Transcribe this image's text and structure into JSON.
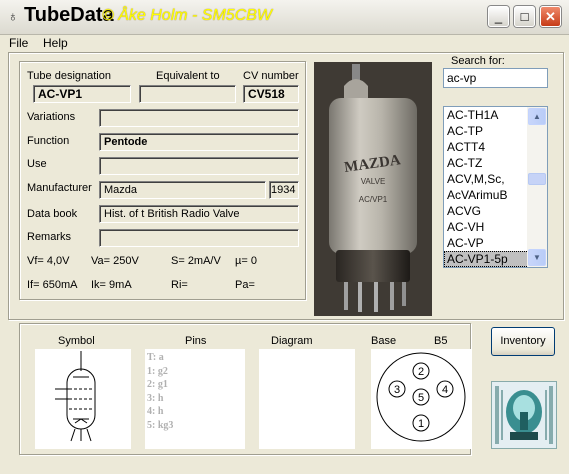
{
  "window": {
    "title": "TubeData",
    "author": "© Åke Holm - SM5CBW",
    "app_icon": "tube-icon",
    "controls": {
      "minimize": "_",
      "maximize": "□",
      "close": "✕"
    }
  },
  "menu": {
    "file": "File",
    "help": "Help"
  },
  "details": {
    "tube_designation_label": "Tube designation",
    "tube_designation_value": "AC-VP1",
    "equivalent_label": "Equivalent to",
    "equivalent_value": "",
    "cv_label": "CV number",
    "cv_value": "CV518",
    "variations_label": "Variations",
    "variations_value": "",
    "function_label": "Function",
    "function_value": "Pentode",
    "use_label": "Use",
    "use_value": "",
    "manufacturer_label": "Manufacturer",
    "manufacturer_value": "Mazda",
    "year_value": "1934",
    "databook_label": "Data book",
    "databook_value": "Hist. of t British Radio Valve",
    "remarks_label": "Remarks",
    "remarks_value": "",
    "vf": "Vf= 4,0V",
    "va": "Va= 250V",
    "s": "S= 2mA/V",
    "mu": "µ=   0",
    "if": "If= 650mA",
    "ik": "Ik=  9mA",
    "ri": "Ri=",
    "pa": "Pa="
  },
  "photo": {
    "brand": "MAZDA",
    "valve": "VALVE",
    "type": "AC/VP1"
  },
  "search": {
    "label": "Search for:",
    "value": "ac-vp",
    "results": [
      "AC-TH1A",
      "AC-TP",
      "ACTT4",
      "AC-TZ",
      "ACV,M,Sc,",
      "AcVArimuB",
      "ACVG",
      "AC-VH",
      "AC-VP",
      "AC-VP1-5p"
    ],
    "selected_index": 9
  },
  "bottom": {
    "symbol_label": "Symbol",
    "pins_label": "Pins",
    "diagram_label": "Diagram",
    "base_label": "Base",
    "base_type": "B5",
    "pins": [
      "T: a",
      "1: g2",
      "2: g1",
      "3: h",
      "4: h",
      "5: kg3"
    ],
    "base_pin_numbers": [
      "1",
      "2",
      "3",
      "4",
      "5"
    ]
  },
  "inventory_label": "Inventory",
  "colors": {
    "title_author": "#ffff00",
    "close_button": "#c63b17",
    "face": "#ece9d8"
  }
}
